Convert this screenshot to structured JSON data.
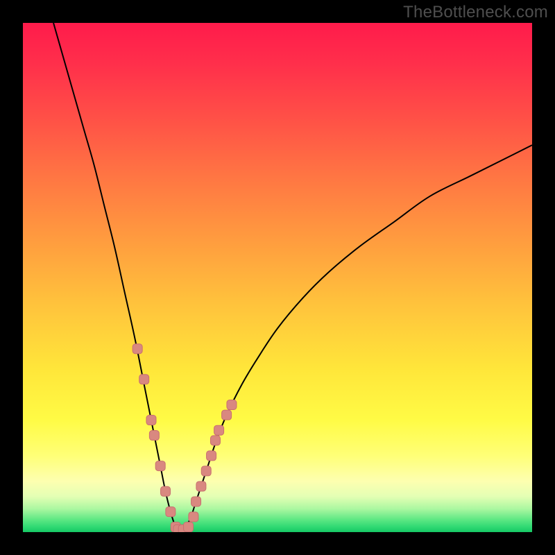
{
  "watermark": "TheBottleneck.com",
  "colors": {
    "frame": "#000000",
    "curve_stroke": "#000000",
    "marker_fill": "#d98880",
    "marker_stroke": "#c86f6f",
    "gradient_stops": [
      {
        "offset": 0.0,
        "color": "#ff1b4b"
      },
      {
        "offset": 0.08,
        "color": "#ff2f4b"
      },
      {
        "offset": 0.18,
        "color": "#ff4e47"
      },
      {
        "offset": 0.3,
        "color": "#ff7543"
      },
      {
        "offset": 0.42,
        "color": "#ff9a3f"
      },
      {
        "offset": 0.55,
        "color": "#ffc23c"
      },
      {
        "offset": 0.68,
        "color": "#ffe63a"
      },
      {
        "offset": 0.78,
        "color": "#fffb45"
      },
      {
        "offset": 0.85,
        "color": "#ffff77"
      },
      {
        "offset": 0.9,
        "color": "#fdffb0"
      },
      {
        "offset": 0.93,
        "color": "#e4ffb4"
      },
      {
        "offset": 0.955,
        "color": "#a9f7a0"
      },
      {
        "offset": 0.975,
        "color": "#5fe884"
      },
      {
        "offset": 0.99,
        "color": "#2fd973"
      },
      {
        "offset": 1.0,
        "color": "#16c864"
      }
    ]
  },
  "chart_data": {
    "type": "line",
    "title": "",
    "xlabel": "",
    "ylabel": "",
    "xlim": [
      0,
      100
    ],
    "ylim": [
      0,
      100
    ],
    "series": [
      {
        "name": "bottleneck-curve",
        "x": [
          6,
          8,
          10,
          12,
          14,
          16,
          18,
          20,
          22,
          24,
          25,
          26,
          27,
          28,
          29,
          30,
          31,
          32,
          33,
          34,
          36,
          38,
          40,
          43,
          46,
          50,
          55,
          60,
          66,
          73,
          80,
          88,
          96,
          100
        ],
        "y": [
          100,
          93,
          86,
          79,
          72,
          64,
          56,
          47,
          38,
          28,
          23,
          18,
          13,
          8,
          4,
          1,
          0,
          1,
          3,
          6,
          12,
          18,
          23,
          29,
          34,
          40,
          46,
          51,
          56,
          61,
          66,
          70,
          74,
          76
        ]
      }
    ],
    "markers": {
      "name": "highlighted-points",
      "x": [
        22.5,
        23.8,
        25.2,
        25.8,
        27.0,
        28.0,
        29.0,
        30.0,
        30.5,
        31.5,
        32.5,
        33.5,
        34.0,
        35.0,
        36.0,
        37.0,
        37.8,
        38.5,
        40.0,
        41.0
      ],
      "y": [
        36,
        30,
        22,
        19,
        13,
        8,
        4,
        1,
        0.5,
        0.5,
        1,
        3,
        6,
        9,
        12,
        15,
        18,
        20,
        23,
        25
      ]
    }
  }
}
